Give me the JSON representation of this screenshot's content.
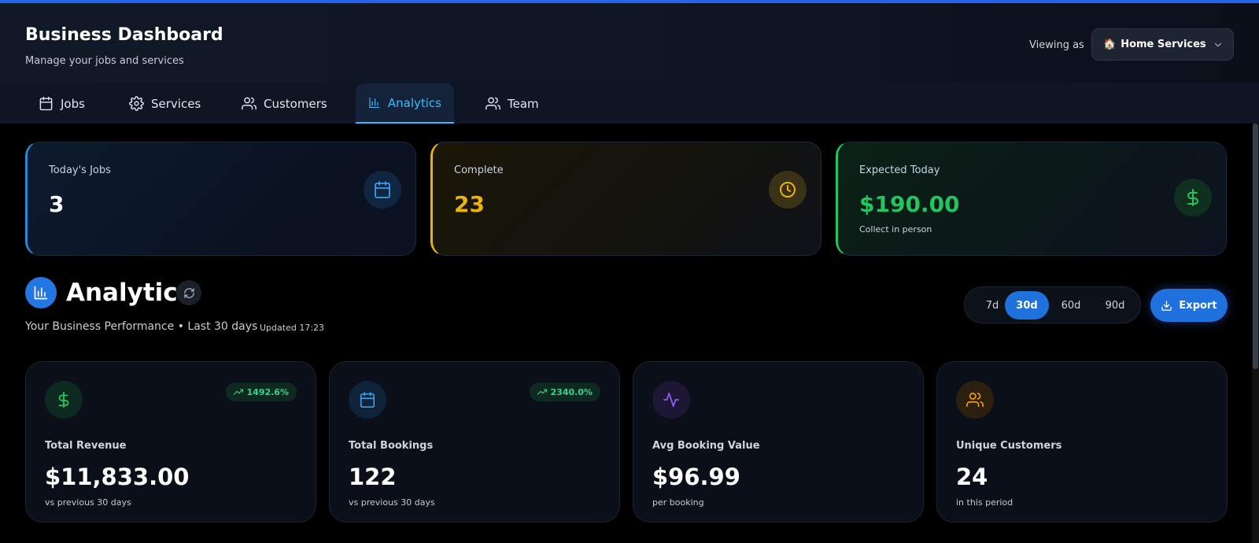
{
  "header": {
    "title": "Business Dashboard",
    "subtitle": "Manage your jobs and services",
    "viewing_label": "Viewing as",
    "viewing_value": "Home Services",
    "viewing_emoji": "🏠"
  },
  "tabs": [
    {
      "label": "Jobs",
      "icon": "calendar-icon",
      "active": false
    },
    {
      "label": "Services",
      "icon": "gear-icon",
      "active": false
    },
    {
      "label": "Customers",
      "icon": "users-icon",
      "active": false
    },
    {
      "label": "Analytics",
      "icon": "bar-chart-icon",
      "active": true
    },
    {
      "label": "Team",
      "icon": "users-icon",
      "active": false
    }
  ],
  "stats": [
    {
      "label": "Today's Jobs",
      "value": "3",
      "sub": "",
      "icon": "calendar-icon",
      "accent": "#2789d6",
      "value_color": "#ffffff"
    },
    {
      "label": "Complete",
      "value": "23",
      "sub": "",
      "icon": "clock-icon",
      "accent": "#eab308",
      "value_color": "#eab308"
    },
    {
      "label": "Expected Today",
      "value": "$190.00",
      "sub": "Collect in person",
      "icon": "dollar-icon",
      "accent": "#22c55e",
      "value_color": "#22c55e"
    }
  ],
  "analytics": {
    "title": "Analytics",
    "subtitle": "Your Business Performance • Last 30 days",
    "updated": "Updated 17:23",
    "ranges": [
      "7d",
      "30d",
      "60d",
      "90d"
    ],
    "selected_range": "30d",
    "export_label": "Export"
  },
  "metrics": [
    {
      "label": "Total Revenue",
      "value": "$11,833.00",
      "sub": "vs previous 30 days",
      "badge": "1492.6%",
      "icon": "dollar-icon",
      "color": "#22c55e"
    },
    {
      "label": "Total Bookings",
      "value": "122",
      "sub": "vs previous 30 days",
      "badge": "2340.0%",
      "icon": "calendar-icon",
      "color": "#3b9de8"
    },
    {
      "label": "Avg Booking Value",
      "value": "$96.99",
      "sub": "per booking",
      "badge": "",
      "icon": "activity-icon",
      "color": "#8b5cf6"
    },
    {
      "label": "Unique Customers",
      "value": "24",
      "sub": "in this period",
      "badge": "",
      "icon": "users-icon",
      "color": "#f59e0b"
    }
  ]
}
